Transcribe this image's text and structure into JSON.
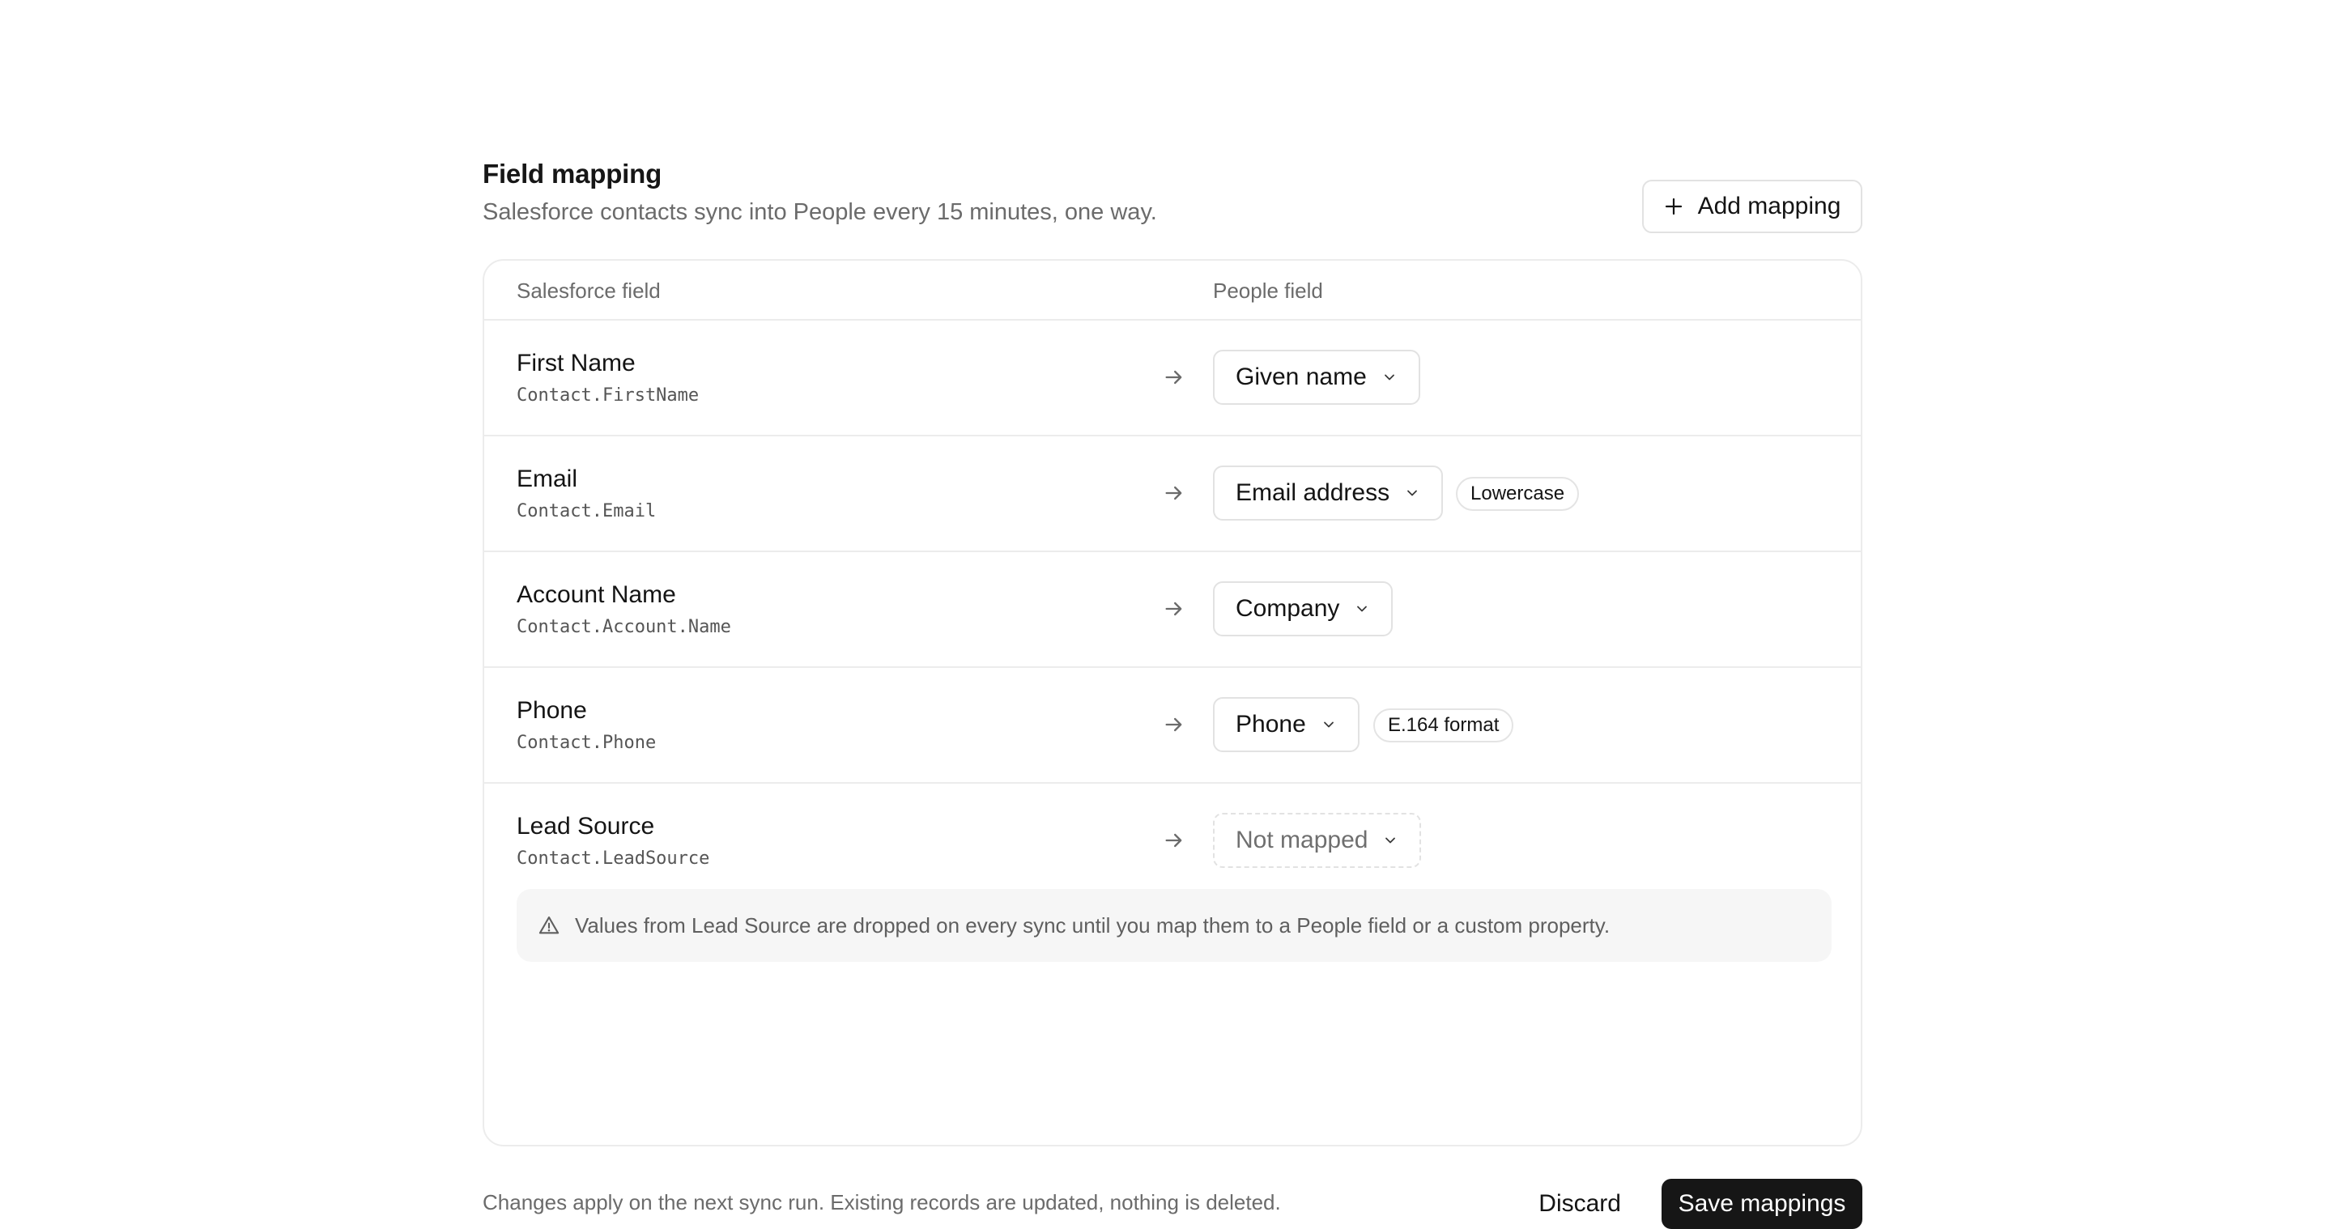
{
  "header": {
    "title": "Field mapping",
    "subtitle": "Salesforce contacts sync into People every 15 minutes, one way.",
    "add_button_label": "Add mapping"
  },
  "table": {
    "columns": [
      "Salesforce field",
      "People field"
    ],
    "rows": [
      {
        "label": "First Name",
        "api": "Contact.FirstName",
        "selected": "Given name",
        "badge": ""
      },
      {
        "label": "Email",
        "api": "Contact.Email",
        "selected": "Email address",
        "badge": "Lowercase"
      },
      {
        "label": "Account Name",
        "api": "Contact.Account.Name",
        "selected": "Company",
        "badge": ""
      },
      {
        "label": "Phone",
        "api": "Contact.Phone",
        "selected": "Phone",
        "badge": "E.164 format"
      },
      {
        "label": "Lead Source",
        "api": "Contact.LeadSource",
        "selected": "Not mapped",
        "badge": ""
      }
    ],
    "warning": "Values from Lead Source are dropped on every sync until you map them to a People field or a custom property."
  },
  "footer": {
    "note": "Changes apply on the next sync run. Existing records are updated, nothing is deleted.",
    "discard_label": "Discard",
    "save_label": "Save mappings"
  },
  "icons": {
    "add": "plus-icon",
    "arrow": "arrow-right-icon",
    "dropdown": "chevron-down-icon",
    "warning": "warning-triangle-icon"
  },
  "colors": {
    "primary_button": "#161616",
    "border": "#ececec",
    "muted_text": "#6b6b6b"
  }
}
